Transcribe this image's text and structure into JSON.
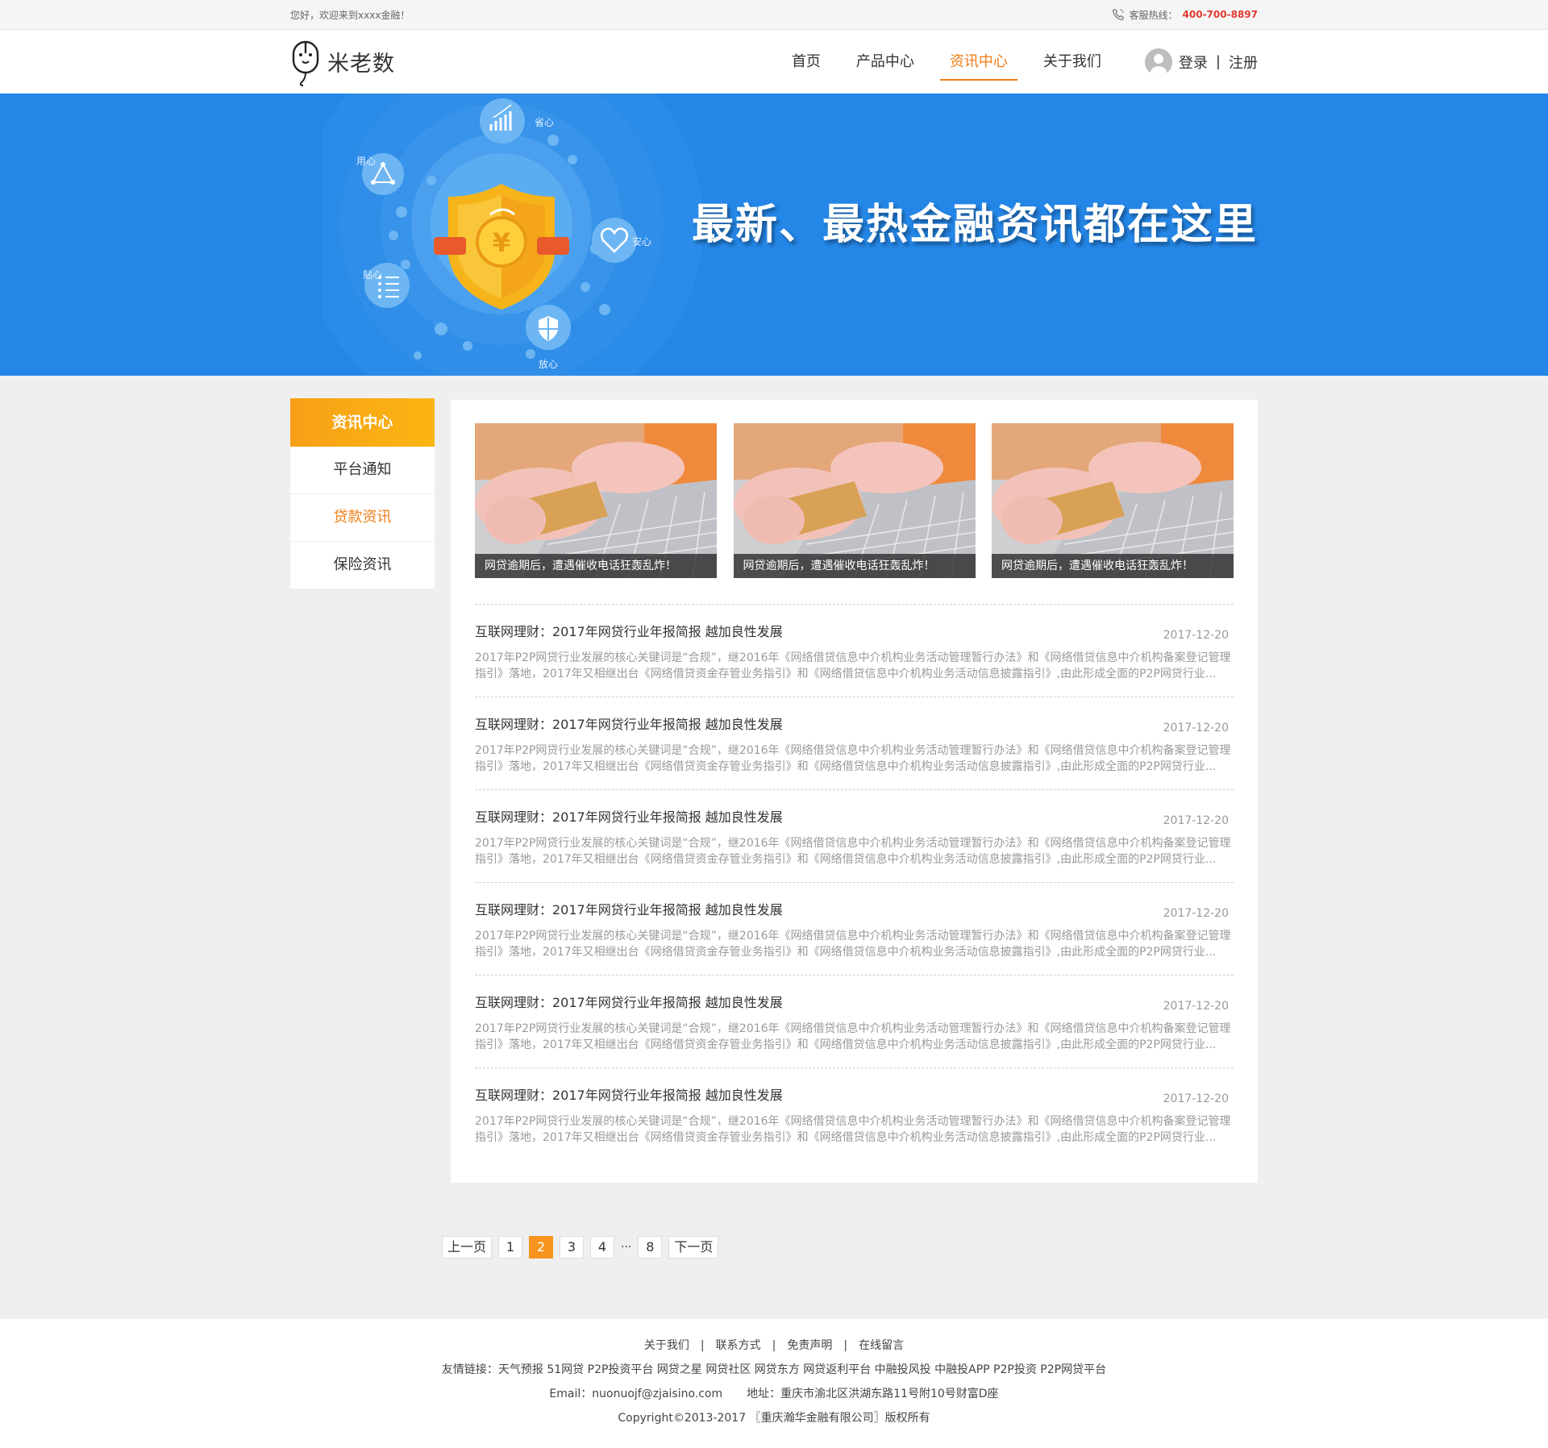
{
  "topbar": {
    "welcome": "您好，欢迎来到xxxx金融！",
    "hotline_label": "客服热线：",
    "hotline_number": "400-700-8897"
  },
  "header": {
    "logo_text": "米老数",
    "nav": [
      "首页",
      "产品中心",
      "资讯中心",
      "关于我们"
    ],
    "active_nav": "资讯中心",
    "login": "登录",
    "sep": "|",
    "register": "注册"
  },
  "banner": {
    "title": "最新、最热金融资讯都在这里",
    "icon_labels": [
      "省心",
      "用心",
      "安心",
      "贴心",
      "放心"
    ]
  },
  "sidebar": {
    "title": "资讯中心",
    "items": [
      "平台通知",
      "贷款资讯",
      "保险资讯"
    ],
    "active": "贷款资讯"
  },
  "thumbs": [
    {
      "caption": "网贷逾期后，遭遇催收电话狂轰乱炸！"
    },
    {
      "caption": "网贷逾期后，遭遇催收电话狂轰乱炸！"
    },
    {
      "caption": "网贷逾期后，遭遇催收电话狂轰乱炸！"
    }
  ],
  "news": [
    {
      "title": "互联网理财：2017年网贷行业年报简报 越加良性发展",
      "date": "2017-12-20",
      "desc": "2017年P2P网贷行业发展的核心关键词是“合规”，继2016年《网络借贷信息中介机构业务活动管理暂行办法》和《网络借贷信息中介机构备案登记管理指引》落地，2017年又相继出台《网络借贷资金存管业务指引》和《网络借贷信息中介机构业务活动信息披露指引》,由此形成全面的P2P网贷行业..."
    },
    {
      "title": "互联网理财：2017年网贷行业年报简报 越加良性发展",
      "date": "2017-12-20",
      "desc": "2017年P2P网贷行业发展的核心关键词是“合规”，继2016年《网络借贷信息中介机构业务活动管理暂行办法》和《网络借贷信息中介机构备案登记管理指引》落地，2017年又相继出台《网络借贷资金存管业务指引》和《网络借贷信息中介机构业务活动信息披露指引》,由此形成全面的P2P网贷行业..."
    },
    {
      "title": "互联网理财：2017年网贷行业年报简报 越加良性发展",
      "date": "2017-12-20",
      "desc": "2017年P2P网贷行业发展的核心关键词是“合规”，继2016年《网络借贷信息中介机构业务活动管理暂行办法》和《网络借贷信息中介机构备案登记管理指引》落地，2017年又相继出台《网络借贷资金存管业务指引》和《网络借贷信息中介机构业务活动信息披露指引》,由此形成全面的P2P网贷行业..."
    },
    {
      "title": "互联网理财：2017年网贷行业年报简报 越加良性发展",
      "date": "2017-12-20",
      "desc": "2017年P2P网贷行业发展的核心关键词是“合规”，继2016年《网络借贷信息中介机构业务活动管理暂行办法》和《网络借贷信息中介机构备案登记管理指引》落地，2017年又相继出台《网络借贷资金存管业务指引》和《网络借贷信息中介机构业务活动信息披露指引》,由此形成全面的P2P网贷行业..."
    },
    {
      "title": "互联网理财：2017年网贷行业年报简报 越加良性发展",
      "date": "2017-12-20",
      "desc": "2017年P2P网贷行业发展的核心关键词是“合规”，继2016年《网络借贷信息中介机构业务活动管理暂行办法》和《网络借贷信息中介机构备案登记管理指引》落地，2017年又相继出台《网络借贷资金存管业务指引》和《网络借贷信息中介机构业务活动信息披露指引》,由此形成全面的P2P网贷行业..."
    },
    {
      "title": "互联网理财：2017年网贷行业年报简报 越加良性发展",
      "date": "2017-12-20",
      "desc": "2017年P2P网贷行业发展的核心关键词是“合规”，继2016年《网络借贷信息中介机构业务活动管理暂行办法》和《网络借贷信息中介机构备案登记管理指引》落地，2017年又相继出台《网络借贷资金存管业务指引》和《网络借贷信息中介机构业务活动信息披露指引》,由此形成全面的P2P网贷行业..."
    }
  ],
  "pager": {
    "prev": "上一页",
    "pages": [
      "1",
      "2",
      "3",
      "4"
    ],
    "current": "2",
    "ellipsis": "···",
    "last": "8",
    "next": "下一页"
  },
  "footer": {
    "links": [
      "关于我们",
      "联系方式",
      "免责声明",
      "在线留言"
    ],
    "friend_links": "友情链接：天气预报  51网贷  P2P投资平台  网贷之星  网贷社区  网贷东方  网贷返利平台  中融投风投  中融投APP   P2P投资  P2P网贷平台",
    "email": "Email：nuonuojf@zjaisino.com",
    "address": "地址：重庆市渝北区洪湖东路11号附10号财富D座",
    "copyright": "Copyright©2013-2017   〖重庆瀚华金融有限公司〗版权所有"
  },
  "colors": {
    "accent": "#f07d17",
    "banner": "#2486e6",
    "sidebar_head": "#f9a817",
    "hotline": "#e23b2f"
  }
}
